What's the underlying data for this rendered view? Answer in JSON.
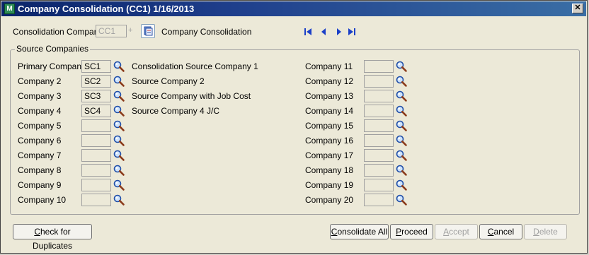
{
  "window": {
    "title": "Company Consolidation (CC1) 1/16/2013",
    "close_glyph": "✕"
  },
  "header": {
    "consolidation_company_label": "Consolidation Company",
    "consolidation_company_value": "CC1",
    "consolidation_company_name": "Company Consolidation"
  },
  "source_companies": {
    "title": "Source Companies",
    "left": [
      {
        "label": "Primary Company",
        "code": "SC1",
        "name": "Consolidation Source Company 1"
      },
      {
        "label": "Company 2",
        "code": "SC2",
        "name": "Source Company 2"
      },
      {
        "label": "Company 3",
        "code": "SC3",
        "name": "Source Company with Job Cost"
      },
      {
        "label": "Company 4",
        "code": "SC4",
        "name": "Source Company 4 J/C"
      },
      {
        "label": "Company 5",
        "code": "",
        "name": ""
      },
      {
        "label": "Company 6",
        "code": "",
        "name": ""
      },
      {
        "label": "Company 7",
        "code": "",
        "name": ""
      },
      {
        "label": "Company 8",
        "code": "",
        "name": ""
      },
      {
        "label": "Company 9",
        "code": "",
        "name": ""
      },
      {
        "label": "Company 10",
        "code": "",
        "name": ""
      }
    ],
    "right": [
      {
        "label": "Company 11",
        "code": ""
      },
      {
        "label": "Company 12",
        "code": ""
      },
      {
        "label": "Company 13",
        "code": ""
      },
      {
        "label": "Company 14",
        "code": ""
      },
      {
        "label": "Company 15",
        "code": ""
      },
      {
        "label": "Company 16",
        "code": ""
      },
      {
        "label": "Company 17",
        "code": ""
      },
      {
        "label": "Company 18",
        "code": ""
      },
      {
        "label": "Company 19",
        "code": ""
      },
      {
        "label": "Company 20",
        "code": ""
      }
    ]
  },
  "buttons": {
    "check_duplicates": {
      "key": "C",
      "rest": "heck for Duplicates"
    },
    "consolidate_all": {
      "key": "C",
      "rest": "onsolidate All"
    },
    "proceed": {
      "key": "P",
      "rest": "roceed"
    },
    "accept": {
      "key": "A",
      "rest": "ccept"
    },
    "cancel": {
      "key": "C",
      "rest": "ancel"
    },
    "delete": {
      "key": "D",
      "rest": "elete"
    }
  },
  "icons": {
    "lookup": "magnifier-icon",
    "nav": [
      "first-record-icon",
      "previous-record-icon",
      "next-record-icon",
      "last-record-icon"
    ]
  },
  "colors": {
    "title_bar": "#0a246a",
    "nav_arrows": "#1a3fc8"
  }
}
